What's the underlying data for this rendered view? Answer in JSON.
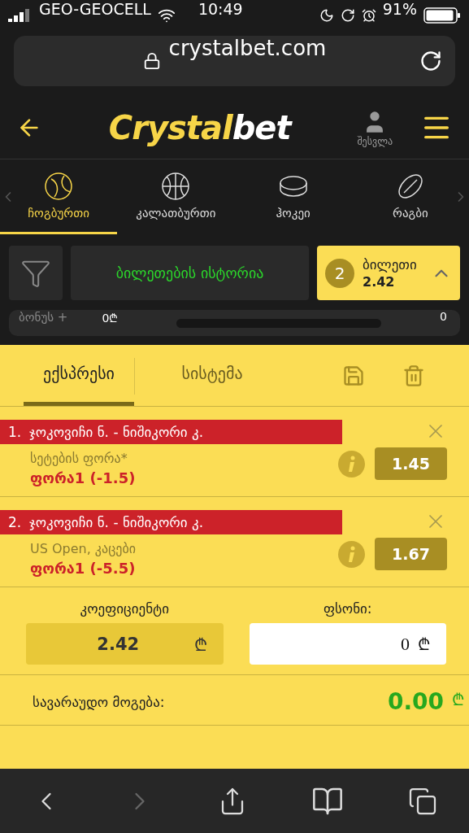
{
  "status_bar": {
    "carrier": "GEO-GEOCELL",
    "time": "10:49",
    "battery": "91%"
  },
  "browser": {
    "url": "crystalbet.com"
  },
  "header": {
    "logo_first": "Crystal",
    "logo_second": "bet",
    "login": "შესვლა"
  },
  "sports": [
    {
      "label": "ჩოგბურთი",
      "selected": true,
      "kind": "tennis"
    },
    {
      "label": "კალათბურთი",
      "selected": false,
      "kind": "basketball"
    },
    {
      "label": "ჰოკეი",
      "selected": false,
      "kind": "hockey"
    },
    {
      "label": "რაგბი",
      "selected": false,
      "kind": "rugby"
    }
  ],
  "history_button": "ბილეთების ისტორია",
  "ticket": {
    "count": "2",
    "label": "ბილეთი",
    "odds": "2.42"
  },
  "bonus": {
    "label": "ბონუს +",
    "amount": "0₾",
    "level": 0,
    "count": "0"
  },
  "bet_tabs": [
    {
      "label": "ექსპრესი",
      "selected": true
    },
    {
      "label": "სისტემა",
      "selected": false
    }
  ],
  "bets": [
    {
      "number": "1.",
      "event": "ჯოკოვიჩი ნ. - ნიშიკორი კ.",
      "market": "სეტების ფორა*",
      "pick": "ფორა1 (-1.5)",
      "odds": "1.45"
    },
    {
      "number": "2.",
      "event": "ჯოკოვიჩი ნ. - ნიშიკორი კ.",
      "market": "US Open, კაცები",
      "pick": "ფორა1 (-5.5)",
      "odds": "1.67"
    }
  ],
  "summary": {
    "coef_label": "კოეფიციენტი",
    "coef_value": "2.42",
    "coef_currency": "₾",
    "stake_label": "ფსონი:",
    "stake_value": "0",
    "stake_currency": "₾",
    "win_label": "სავარაუდო მოგება:",
    "win_value": "0.00",
    "win_currency": "₾"
  }
}
